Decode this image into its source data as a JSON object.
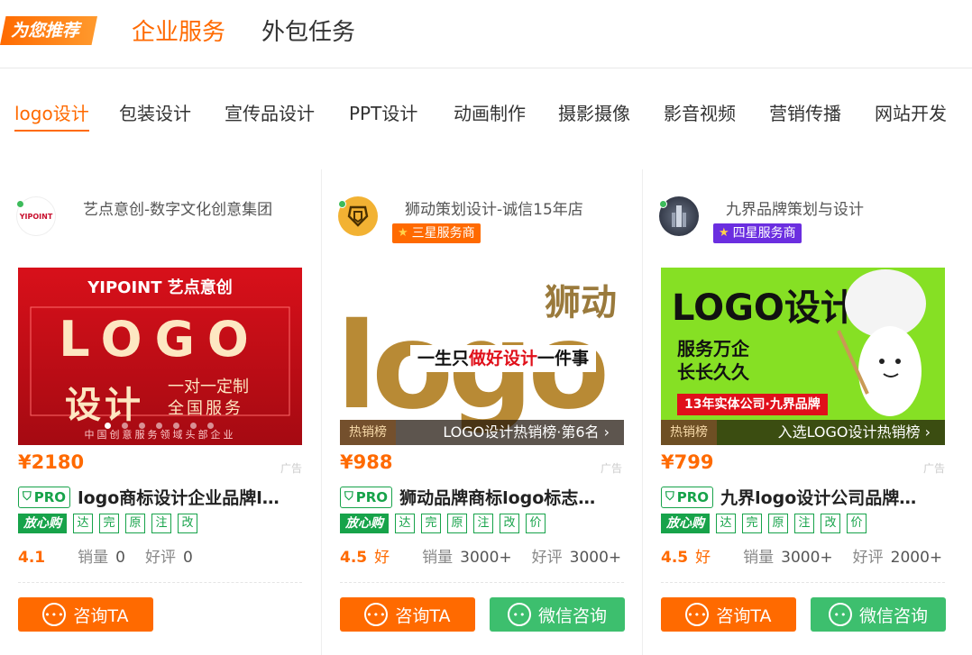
{
  "header": {
    "badge": "为您推荐",
    "tabs": [
      "企业服务",
      "外包任务"
    ]
  },
  "categories": [
    "logo设计",
    "包装设计",
    "宣传品设计",
    "PPT设计",
    "动画制作",
    "摄影摄像",
    "影音视频",
    "营销传播",
    "网站开发"
  ],
  "active_category": "logo设计",
  "cards": [
    {
      "shop": "艺点意创-数字文化创意集团",
      "logo_text": "YIPOINT",
      "price": "¥2180",
      "ad": "广告",
      "pro": "PRO",
      "title": "logo商标设计企业品牌logo设计",
      "badge_fangxin": "放心购",
      "tags": [
        "达",
        "完",
        "原",
        "注",
        "改"
      ],
      "rating": "4.1",
      "sales_label": "销量",
      "sales": "0",
      "reviews_label": "好评",
      "reviews": "0",
      "btn_consult": "咨询TA",
      "thumb": {
        "brand": "YIPOINT 艺点意创",
        "logo": "LOGO",
        "left": "设计",
        "line1": "一对一定制",
        "line2": "全国服务",
        "footer": "中国创意服务领域头部企业"
      }
    },
    {
      "shop": "狮动策划设计-诚信15年店",
      "star_badge": "三星服务商",
      "price": "¥988",
      "ad": "广告",
      "pro": "PRO",
      "title": "狮动品牌商标logo标志设计",
      "badge_fangxin": "放心购",
      "tags": [
        "达",
        "完",
        "原",
        "注",
        "改",
        "价"
      ],
      "rating": "4.5",
      "rating_word": "好",
      "sales_label": "销量",
      "sales": "3000+",
      "reviews_label": "好评",
      "reviews": "3000+",
      "btn_consult": "咨询TA",
      "btn_wechat": "微信咨询",
      "thumb": {
        "brand": "狮动",
        "logo": "logo",
        "slogan_a": "一生只",
        "slogan_b": "做好设计",
        "slogan_c": "一件事",
        "hot_tag": "热销榜",
        "hot_text": "LOGO设计热销榜·第6名 ›"
      }
    },
    {
      "shop": "九界品牌策划与设计",
      "star_badge": "四星服务商",
      "price": "¥799",
      "ad": "广告",
      "pro": "PRO",
      "title": "九界logo设计公司品牌设计",
      "badge_fangxin": "放心购",
      "tags": [
        "达",
        "完",
        "原",
        "注",
        "改",
        "价"
      ],
      "rating": "4.5",
      "rating_word": "好",
      "sales_label": "销量",
      "sales": "3000+",
      "reviews_label": "好评",
      "reviews": "2000+",
      "btn_consult": "咨询TA",
      "btn_wechat": "微信咨询",
      "thumb": {
        "logo": "LOGO设计",
        "line1": "服务万企",
        "line2": "长长久久",
        "ribbon": "13年实体公司·九界品牌",
        "hot_tag": "热销榜",
        "hot_text": "入选LOGO设计热销榜 ›"
      }
    }
  ],
  "colors": {
    "accent": "#ff6a00",
    "green": "#17a34a",
    "wechat": "#3dbf6e"
  }
}
